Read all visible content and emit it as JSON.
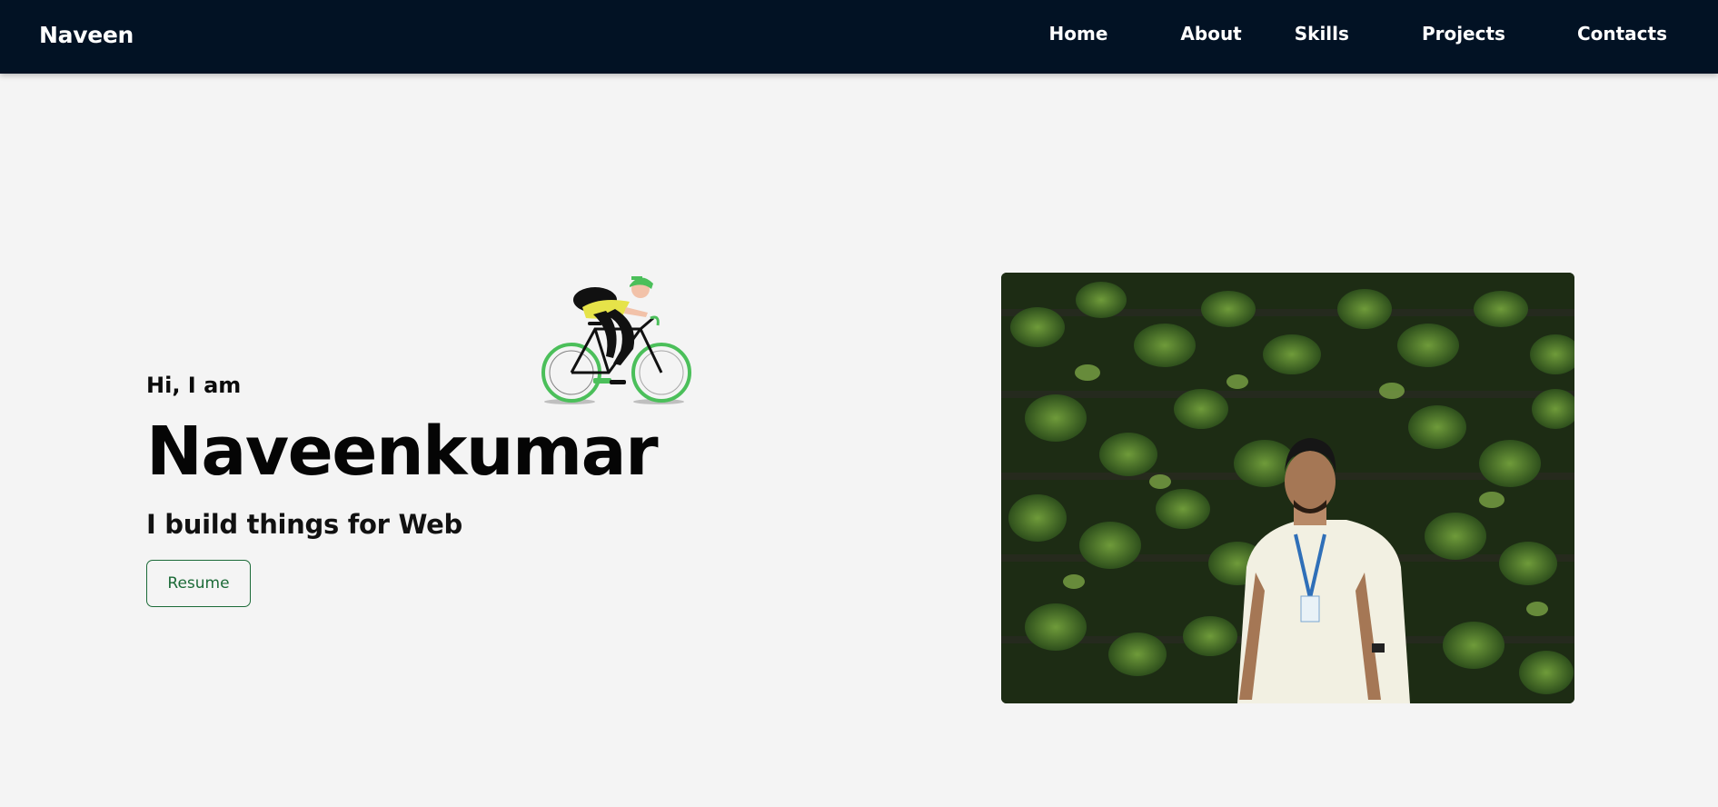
{
  "navbar": {
    "brand": "Naveen",
    "links": [
      {
        "label": "Home"
      },
      {
        "label": "About"
      },
      {
        "label": "Skills"
      },
      {
        "label": "Projects"
      },
      {
        "label": "Contacts"
      }
    ]
  },
  "hero": {
    "greeting": "Hi, I am",
    "name": "Naveenkumar",
    "tagline": "I build things for Web",
    "resume_label": "Resume",
    "cyclist_icon": "cyclist-illustration",
    "photo_icon": "profile-photo"
  },
  "colors": {
    "navbar_bg": "#021224",
    "page_bg": "#f4f4f4",
    "accent_green": "#1c6b38",
    "bike_green": "#4bbf5a"
  }
}
